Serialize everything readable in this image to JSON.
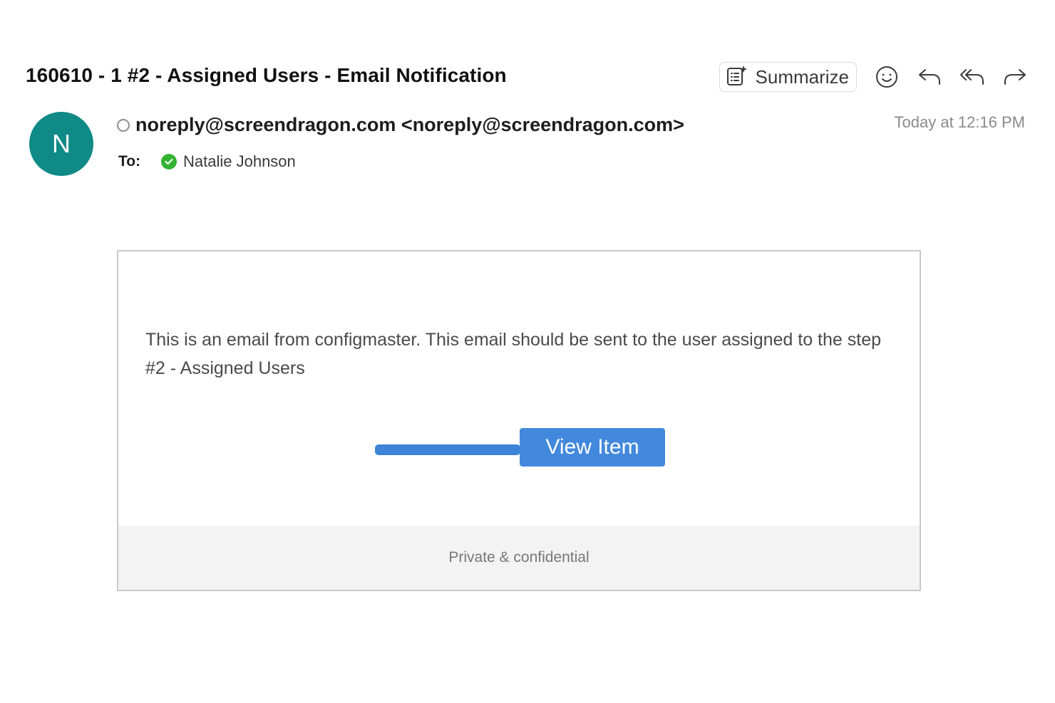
{
  "email": {
    "subject": "160610 - 1 #2 - Assigned Users - Email Notification",
    "from_display": "noreply@screendragon.com <noreply@screendragon.com>",
    "avatar_initial": "N",
    "avatar_color": "#0f8a86",
    "date": "Today at 12:16 PM",
    "to_label": "To:",
    "recipient": "Natalie Johnson",
    "recipient_status_color": "#34b233"
  },
  "toolbar": {
    "summarize_label": "Summarize",
    "icons": [
      "summarize-icon",
      "emoji-reaction-icon",
      "reply-icon",
      "reply-all-icon",
      "forward-icon"
    ]
  },
  "body": {
    "message": "This is an email from configmaster. This email should be sent to the user assigned to the step #2 - Assigned Users",
    "button_label": "View Item",
    "button_color": "#4289dd",
    "footer": "Private & confidential"
  }
}
